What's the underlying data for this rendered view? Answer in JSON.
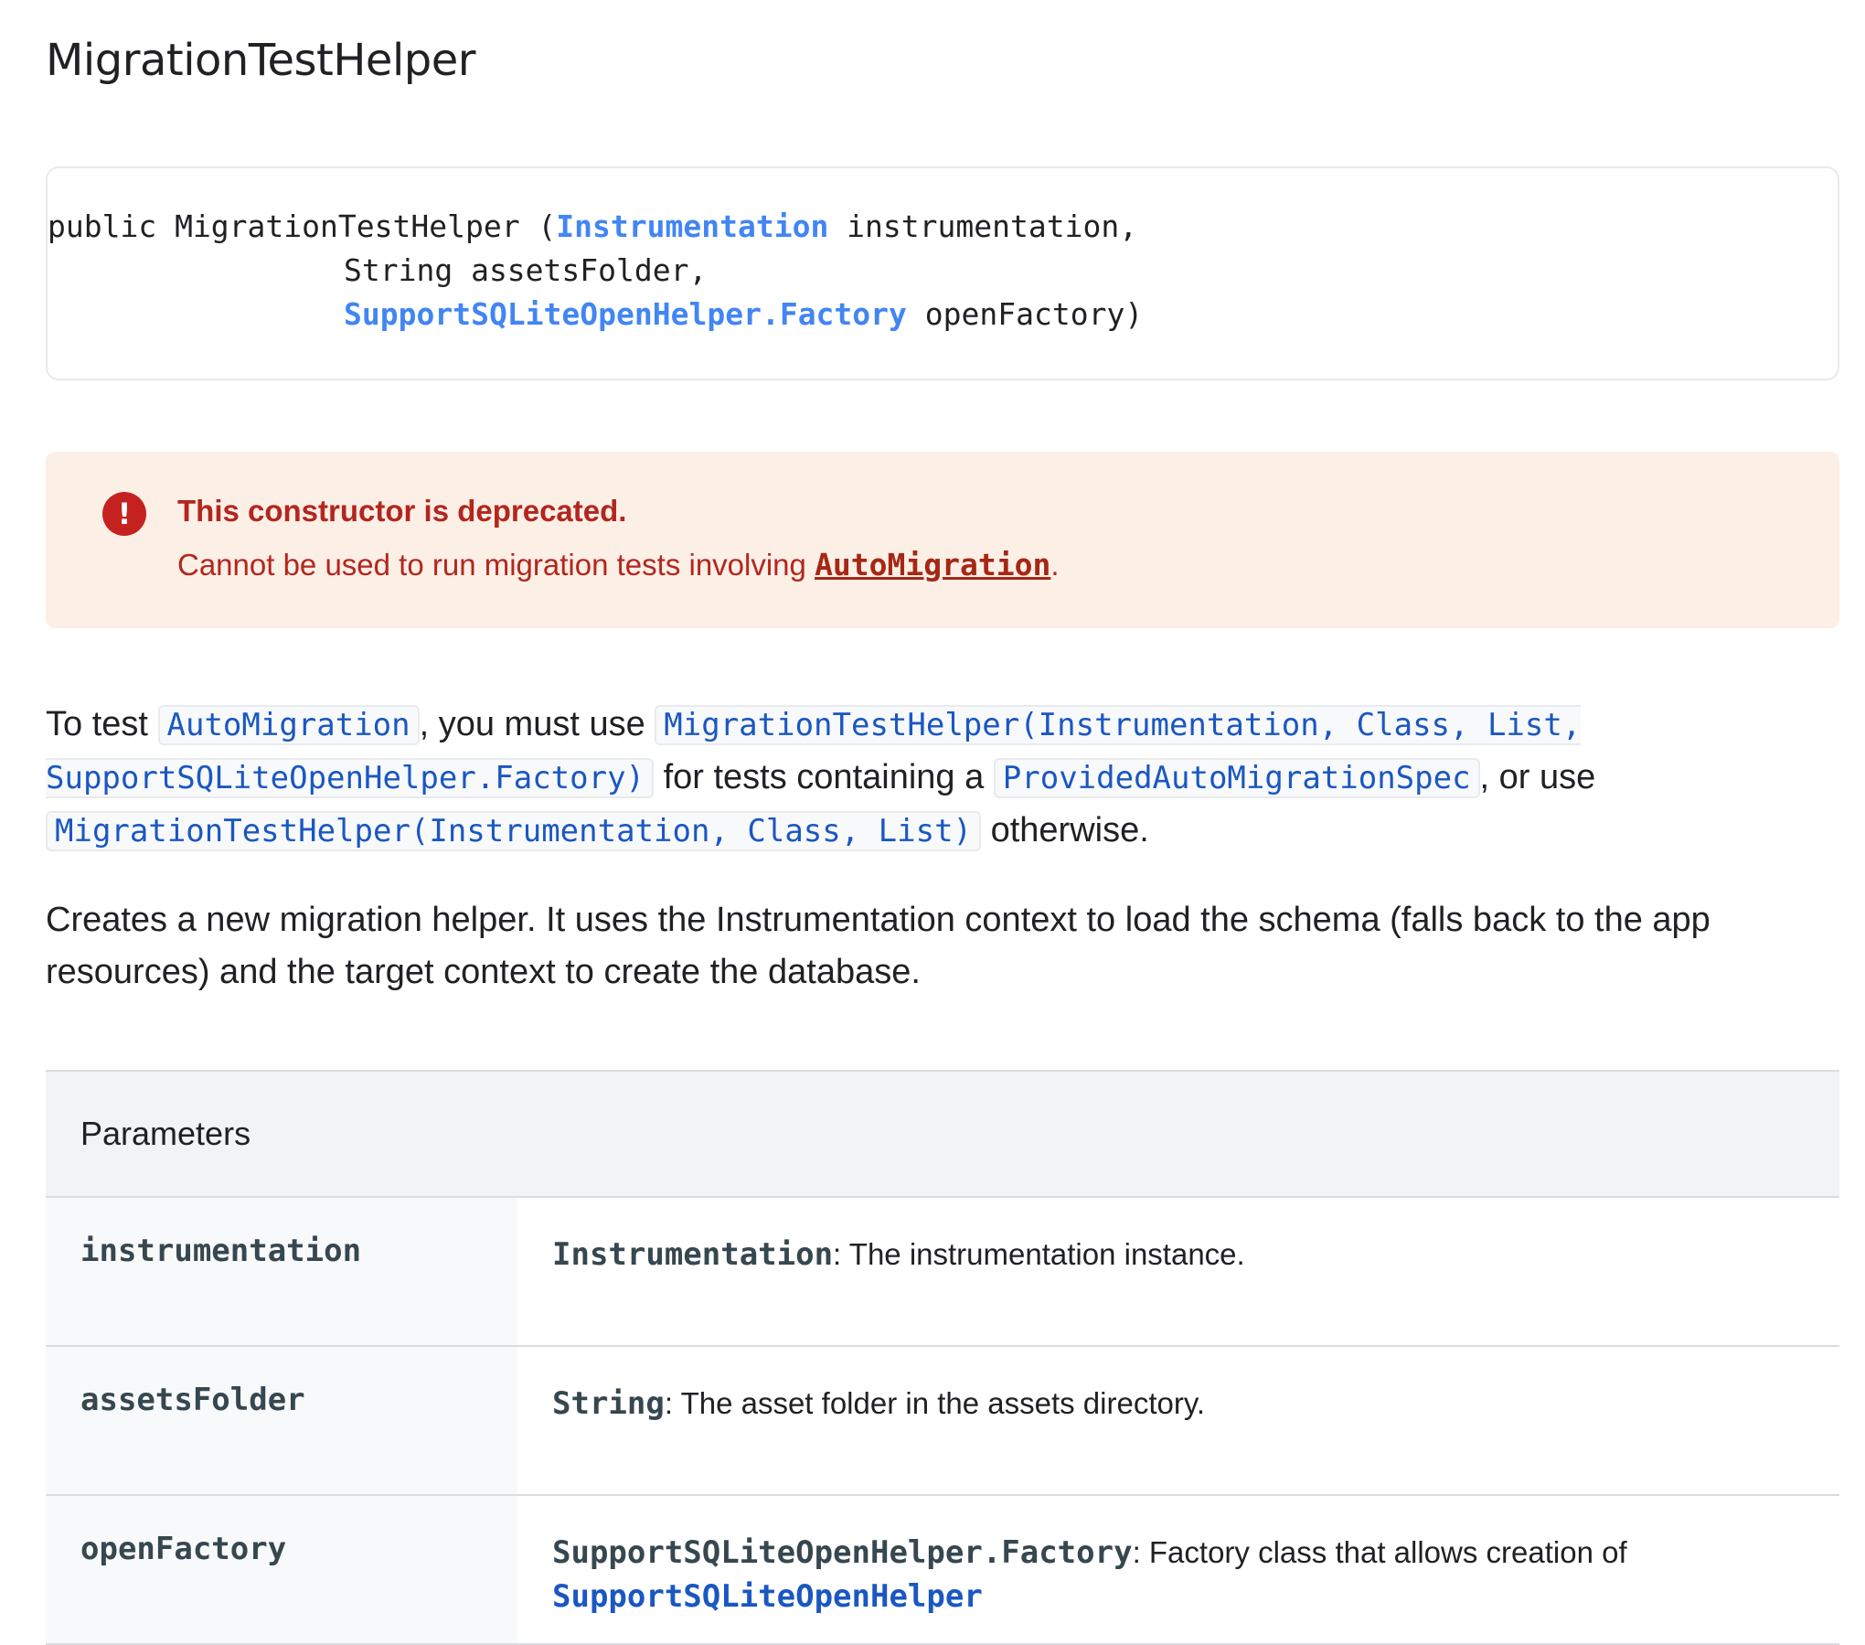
{
  "title": "MigrationTestHelper",
  "signature": {
    "line1_prefix": "public MigrationTestHelper (",
    "line1_type": "Instrumentation",
    "line1_suffix": " instrumentation,",
    "line2": "String assetsFolder,",
    "line3_type": "SupportSQLiteOpenHelper.Factory",
    "line3_suffix": " openFactory)"
  },
  "deprecation": {
    "icon": "exclamation-circle-icon",
    "title": "This constructor is deprecated.",
    "body_prefix": "Cannot be used to run migration tests involving ",
    "body_link": "AutoMigration",
    "body_suffix": "."
  },
  "description": {
    "p1_t1": "To test ",
    "p1_c1": "AutoMigration",
    "p1_t2": ", you must use ",
    "p1_c2": "MigrationTestHelper(Instrumentation, Class, List, SupportSQLiteOpenHelper.Factory)",
    "p1_t3": " for tests containing a ",
    "p1_c3": "ProvidedAutoMigrationSpec",
    "p1_t4": ", or use ",
    "p1_c4": "MigrationTestHelper(Instrumentation, Class, List)",
    "p1_t5": " otherwise.",
    "p2": "Creates a new migration helper. It uses the Instrumentation context to load the schema (falls back to the app resources) and the target context to create the database."
  },
  "parameters": {
    "header": "Parameters",
    "rows": [
      {
        "name": "instrumentation",
        "type": "Instrumentation",
        "desc": ": The instrumentation instance.",
        "link": ""
      },
      {
        "name": "assetsFolder",
        "type": "String",
        "desc": ": The asset folder in the assets directory.",
        "link": ""
      },
      {
        "name": "openFactory",
        "type": "SupportSQLiteOpenHelper.Factory",
        "desc": ": Factory class that allows creation of",
        "link": "SupportSQLiteOpenHelper"
      }
    ]
  },
  "colors": {
    "link": "#4285f4",
    "code_link": "#1a57c2",
    "deprecation_bg": "#fcefe6",
    "deprecation_text": "#b3261e"
  }
}
